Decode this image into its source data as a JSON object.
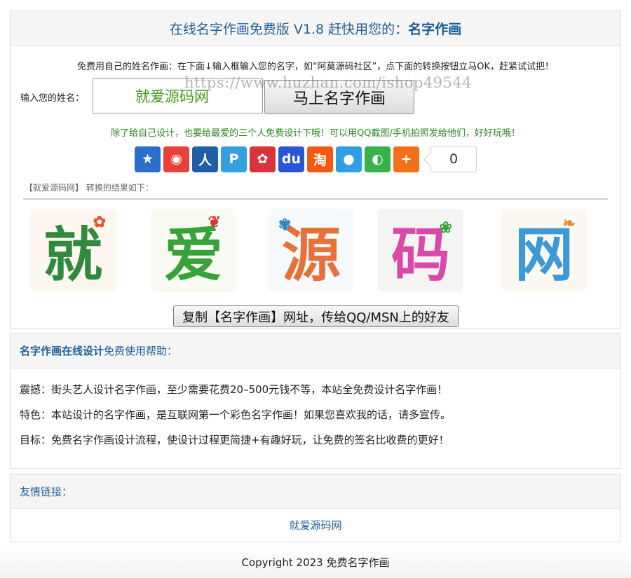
{
  "header": {
    "title_prefix": "在线名字作画免费版 V1.8 赶快用您的：",
    "title_bold": "名字作画"
  },
  "form": {
    "intro": "免费用自己的姓名作画：在下面↓输入框输入您的名字，如“阿莫源码社区”，点下面的转换按钮立马OK，赶紧试试把！",
    "watermark": "https://www.huzhan.com/ishop49544",
    "name_label": "输入您的姓名：",
    "name_value": "就爱源码网",
    "submit_label": "马上名字作画",
    "share_tip": "除了给自己设计，也要给最爱的三个人免费设计下哦！可以用QQ截图/手机拍照发给他们，好好玩哦！"
  },
  "share": {
    "icons": [
      {
        "name": "qzone-icon",
        "glyph": "★",
        "color": "#2a6fc9"
      },
      {
        "name": "weibo-icon",
        "glyph": "◉",
        "color": "#e8403b"
      },
      {
        "name": "renren-icon",
        "glyph": "人",
        "color": "#1f5ea8"
      },
      {
        "name": "pengyou-icon",
        "glyph": "P",
        "color": "#33a1e0"
      },
      {
        "name": "tencent-weibo-icon",
        "glyph": "✿",
        "color": "#d9343c"
      },
      {
        "name": "baidu-icon",
        "glyph": "du",
        "color": "#2a56d6"
      },
      {
        "name": "taobao-icon",
        "glyph": "淘",
        "color": "#f25a12"
      },
      {
        "name": "qq-icon",
        "glyph": "●",
        "color": "#2f9fe3"
      },
      {
        "name": "wechat-icon",
        "glyph": "◐",
        "color": "#36b24a"
      },
      {
        "name": "more-share-icon",
        "glyph": "+",
        "color": "#f3701a"
      }
    ],
    "count": "0"
  },
  "result": {
    "label": "【就爱源码网】 转换的结果如下：",
    "glyphs": [
      {
        "char": "就",
        "color": "#2f8a3e",
        "bg": "#fdf6f1",
        "accent": "#e5552a"
      },
      {
        "char": "爱",
        "color": "#39a13a",
        "bg": "#f8fbf2",
        "accent": "#d8362f"
      },
      {
        "char": "源",
        "color": "#e8713a",
        "bg": "#f6fafc",
        "accent": "#2f86c6"
      },
      {
        "char": "码",
        "color": "#d94aa8",
        "bg": "#f4f4f2",
        "accent": "#3aa540"
      },
      {
        "char": "网",
        "color": "#3b9ad6",
        "bg": "#fbf8f2",
        "accent": "#e48a2a"
      }
    ],
    "copy_label": "复制【名字作画】网址，传给QQ/MSN上的好友"
  },
  "help": {
    "title_bold": "名字作画在线设计",
    "title_rest": "免费使用帮助：",
    "lines": [
      "震撼：街头艺人设计名字作画，至少需要花费20–500元钱不等，本站全免费设计名字作画！",
      "特色：本站设计的名字作画，是互联网第一个彩色名字作画！如果您喜欢我的话，请多宣传。",
      "目标：免费名字作画设计流程，使设计过程更简捷+有趣好玩，让免费的签名比收费的更好！"
    ]
  },
  "links": {
    "title": "友情链接：",
    "items": [
      "就爱源码网"
    ]
  },
  "footer": {
    "copyright": "Copyright 2023 免费名字作画"
  }
}
